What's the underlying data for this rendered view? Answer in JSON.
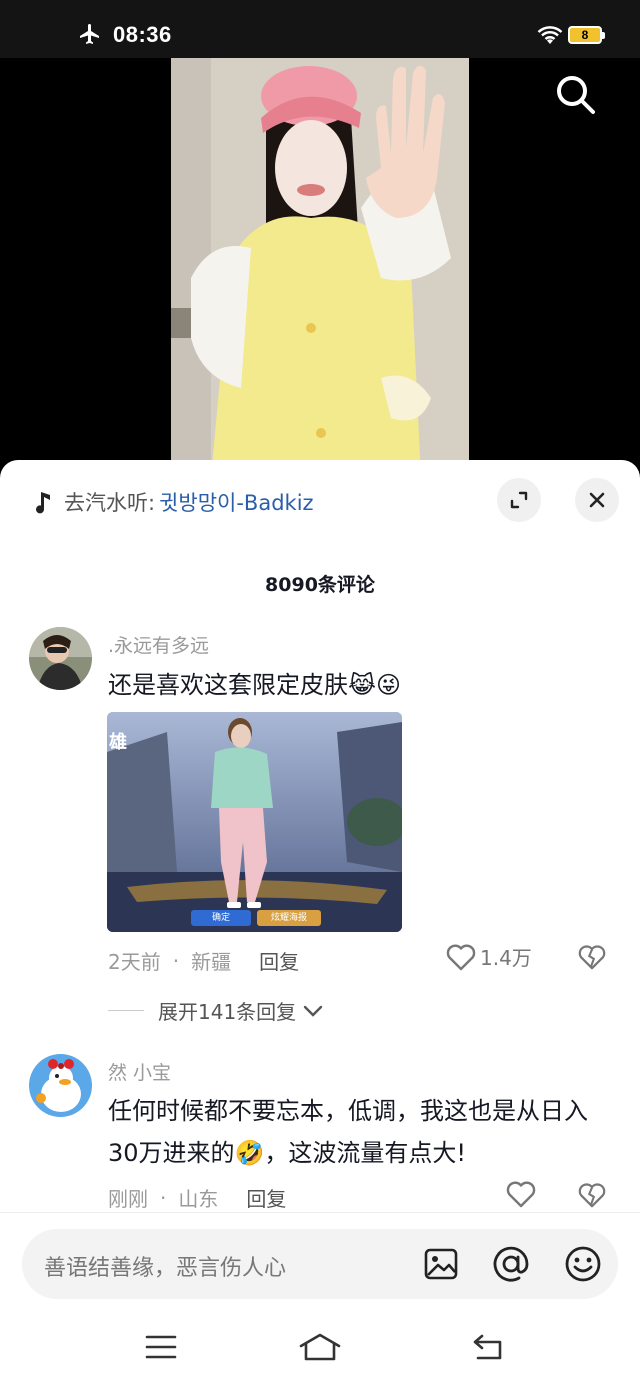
{
  "status_bar": {
    "time": "08:36",
    "battery": "8",
    "airplane_icon": "airplane-icon",
    "wifi_icon": "wifi-icon"
  },
  "video": {
    "search_icon": "search-icon"
  },
  "music": {
    "prefix": "去汽水听:",
    "song": "귓방망이-Badkiz"
  },
  "comments_header": {
    "count": "8090条评论"
  },
  "comments": [
    {
      "username": ".永远有多远",
      "text": "还是喜欢这套限定皮肤😹😜",
      "time": "2天前",
      "location": "新疆",
      "reply_label": "回复",
      "likes": "1.4万",
      "image_buttons": [
        "确定",
        "炫耀海报"
      ]
    },
    {
      "username": "然 小宝",
      "text": "任何时候都不要忘本，低调，我这也是从日入30万进来的🤣，这波流量有点大!",
      "time": "刚刚",
      "location": "山东",
      "reply_label": "回复",
      "likes": ""
    }
  ],
  "expand_replies": {
    "label": "展开141条回复"
  },
  "input": {
    "placeholder": "善语结善缘，恶言伤人心"
  },
  "colors": {
    "song_link": "#2a5ea8",
    "battery": "#f2c12e"
  }
}
